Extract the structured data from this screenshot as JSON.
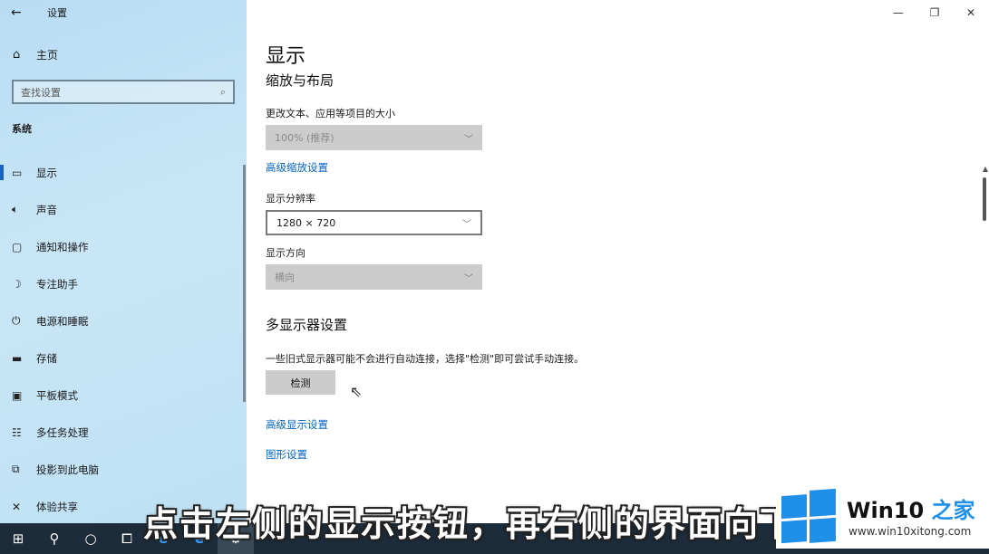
{
  "app": {
    "title": "设置",
    "back_icon": "back-arrow-icon"
  },
  "sidebar": {
    "home_label": "主页",
    "search_placeholder": "查找设置",
    "section": "系统",
    "items": [
      {
        "label": "显示",
        "icon": "monitor-icon",
        "active": true
      },
      {
        "label": "声音",
        "icon": "speaker-icon"
      },
      {
        "label": "通知和操作",
        "icon": "notification-icon"
      },
      {
        "label": "专注助手",
        "icon": "moon-icon"
      },
      {
        "label": "电源和睡眠",
        "icon": "power-icon"
      },
      {
        "label": "存储",
        "icon": "storage-icon"
      },
      {
        "label": "平板模式",
        "icon": "tablet-icon"
      },
      {
        "label": "多任务处理",
        "icon": "multitask-icon"
      },
      {
        "label": "投影到此电脑",
        "icon": "project-icon"
      },
      {
        "label": "体验共享",
        "icon": "share-icon"
      }
    ]
  },
  "main": {
    "page_title": "显示",
    "scale_section": "缩放与布局",
    "scale_label": "更改文本、应用等项目的大小",
    "scale_value": "100% (推荐)",
    "advanced_scaling_link": "高级缩放设置",
    "resolution_label": "显示分辨率",
    "resolution_value": "1280 × 720",
    "orientation_label": "显示方向",
    "orientation_value": "横向",
    "multi_display_section": "多显示器设置",
    "multi_display_desc": "一些旧式显示器可能不会进行自动连接，选择\"检测\"即可尝试手动连接。",
    "detect_button": "检测",
    "advanced_display_link": "高级显示设置",
    "graphics_link": "图形设置"
  },
  "caption": "点击左侧的显示按钮，再右侧的界面向下滑",
  "watermark": {
    "brand_prefix": "Win10",
    "brand_suffix": " 之家",
    "url": "www.win10xitong.com"
  },
  "colors": {
    "accent": "#1565c0",
    "link": "#0563c1",
    "taskbar": "#1c2c3a"
  }
}
